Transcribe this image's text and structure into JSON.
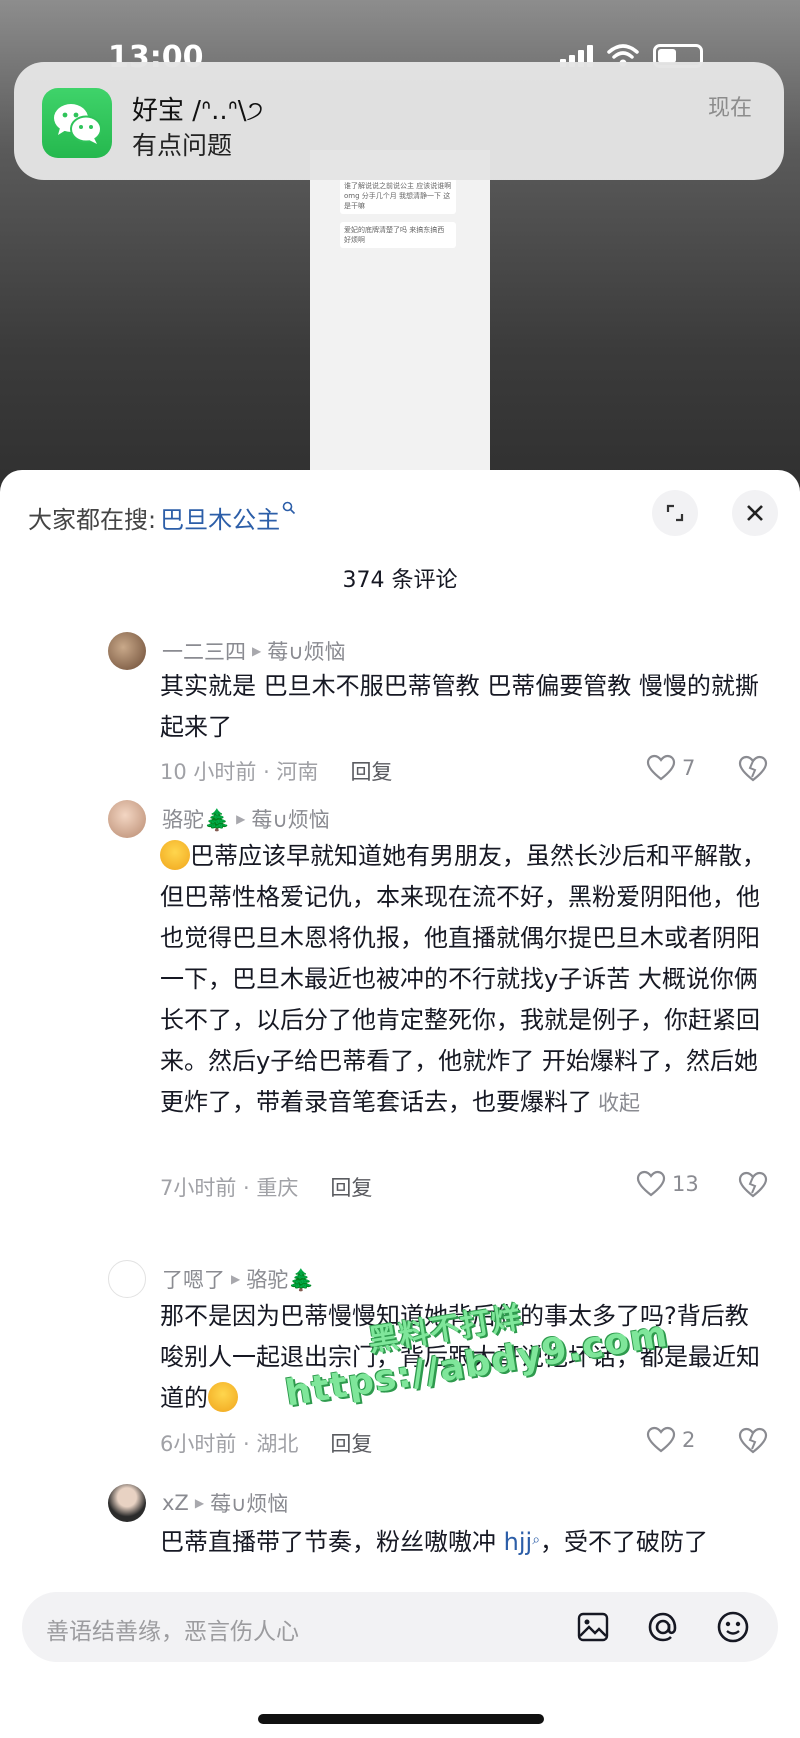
{
  "status_bar": {
    "time": "13:00"
  },
  "notification": {
    "title": "好宝 /ᐢ..ᐢ\\੭",
    "body": "有点问题",
    "time": "现在",
    "app_icon": "wechat-icon"
  },
  "background_chat": {
    "bubble1": "谁了解说说之前说公主 应该说谁啊 omg 分手几个月 我想清静一下 这是干嘛",
    "bubble2": "爱妃的底牌清楚了吗 来搞东搞西 好烦啊"
  },
  "sheet": {
    "search_prefix": "大家都在搜:",
    "search_keyword": "巴旦木公主",
    "comment_count": "374 条评论"
  },
  "comments": [
    {
      "user": "一二三四",
      "reply_to": "莓∪烦恼",
      "text": "其实就是 巴旦木不服巴蒂管教 巴蒂偏要管教 慢慢的就撕起来了",
      "time_loc": "10 小时前 · 河南",
      "reply_label": "回复",
      "likes": "7"
    },
    {
      "user": "骆驼🌲",
      "reply_to": "莓∪烦恼",
      "text": "巴蒂应该早就知道她有男朋友，虽然长沙后和平解散，但巴蒂性格爱记仇，本来现在流不好，黑粉爱阴阳他，他也觉得巴旦木恩将仇报，他直播就偶尔提巴旦木或者阴阳一下，巴旦木最近也被冲的不行就找y子诉苦 大概说你俩长不了，以后分了他肯定整死你，我就是例子，你赶紧回来。然后y子给巴蒂看了，他就炸了 开始爆料了，然后她更炸了，带着录音笔套话去，也要爆料了",
      "collapse": "收起",
      "time_loc": "7小时前 · 重庆",
      "reply_label": "回复",
      "likes": "13"
    },
    {
      "user": "了嗯了",
      "reply_to": "骆驼🌲",
      "text": "那不是因为巴蒂慢慢知道她背后做的事太多了吗?背后教唆别人一起退出宗门，背后跟大哥说他坏话，都是最近知道的",
      "time_loc": "6小时前 · 湖北",
      "reply_label": "回复",
      "likes": "2"
    },
    {
      "user": "xZ",
      "reply_to": "莓∪烦恼",
      "text_before": "巴蒂直播带了节奏，粉丝嗷嗷冲 ",
      "text_link": "hjj",
      "text_after": "，受不了破防了"
    }
  ],
  "watermark": {
    "line1": "黑料不打烊",
    "line2": "https://abdy9.com"
  },
  "input": {
    "placeholder": "善语结善缘，恶言伤人心"
  }
}
